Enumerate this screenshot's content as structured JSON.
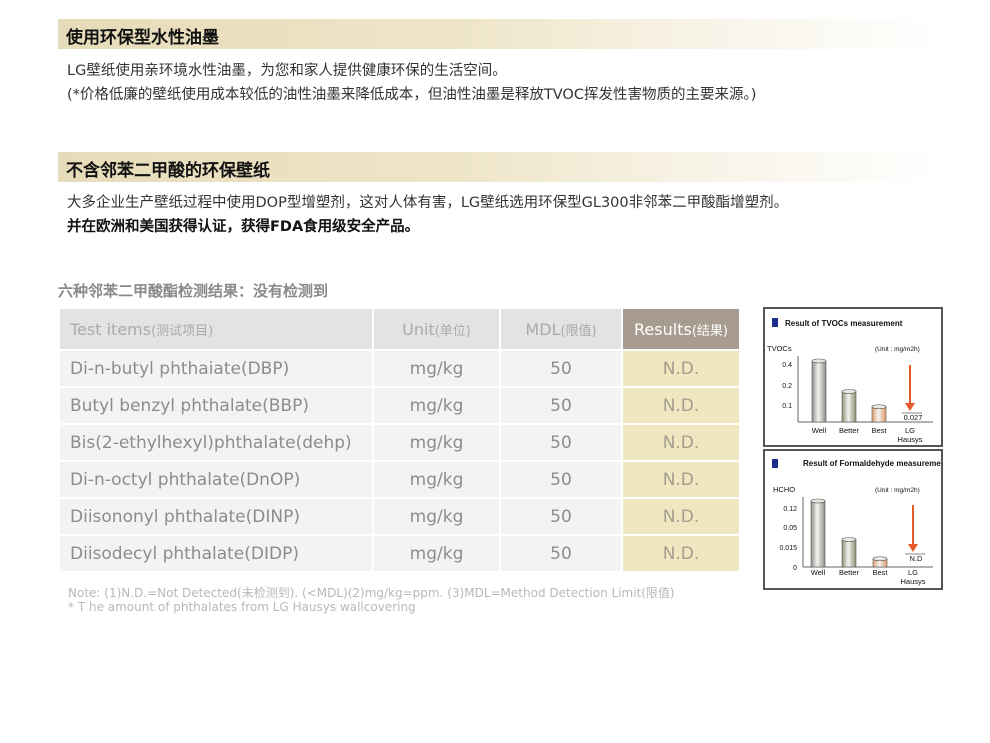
{
  "section1": {
    "title": "使用环保型水性油墨",
    "line1": "LG壁纸使用亲环境水性油墨，为您和家人提供健康环保的生活空间。",
    "line2": "(*价格低廉的壁纸使用成本较低的油性油墨来降低成本，但油性油墨是释放TVOC挥发性害物质的主要来源。)"
  },
  "section2": {
    "title": "不含邻苯二甲酸的环保壁纸",
    "line1": "大多企业生产壁纸过程中使用DOP型增塑剂，这对人体有害，LG壁纸选用环保型GL300非邻苯二甲酸酯增塑剂。",
    "line2": "并在欧洲和美国获得认证，获得FDA食用级安全产品。"
  },
  "table": {
    "title": "六种邻苯二甲酸酯检测结果：没有检测到",
    "headers": {
      "items": "Test items",
      "items_cn": "(测试项目)",
      "unit": "Unit",
      "unit_cn": "(单位)",
      "mdl": "MDL",
      "mdl_cn": "(限值)",
      "results": "Results",
      "results_cn": "(结果)"
    },
    "rows": [
      {
        "item": "Di-n-butyl phthaiate(DBP)",
        "unit": "mg/kg",
        "mdl": "50",
        "result": "N.D."
      },
      {
        "item": "Butyl benzyl phthalate(BBP)",
        "unit": "mg/kg",
        "mdl": "50",
        "result": "N.D."
      },
      {
        "item": "Bis(2-ethylhexyl)phthalate(dehp)",
        "unit": "mg/kg",
        "mdl": "50",
        "result": "N.D."
      },
      {
        "item": "Di-n-octyl phthalate(DnOP)",
        "unit": "mg/kg",
        "mdl": "50",
        "result": "N.D."
      },
      {
        "item": "Diisononyl phthalate(DINP)",
        "unit": "mg/kg",
        "mdl": "50",
        "result": "N.D."
      },
      {
        "item": "Diisodecyl phthalate(DIDP)",
        "unit": "mg/kg",
        "mdl": "50",
        "result": "N.D."
      }
    ],
    "note1": "Note: (1)N.D.=Not Detected(未检测到). (<MDL)(2)mg/kg=ppm. (3)MDL=Method Detection Limit(限值)",
    "note2": "* T he amount of phthalates from LG Hausys wallcovering"
  },
  "chart_data": [
    {
      "type": "bar",
      "title": "Result of TVOCs measurement",
      "ylabel": "TVOCs",
      "unit": "(Unit : mg/m2h)",
      "yticks": [
        "0.4",
        "0.2",
        "0.1"
      ],
      "categories": [
        "Well",
        "Better",
        "Best",
        "LG Hausys"
      ],
      "values": [
        0.4,
        0.2,
        0.1,
        0.027
      ],
      "value_label": "0.027",
      "colors": [
        "#8a8f88",
        "#8e8f72",
        "#e09a6a",
        "#e85a2a"
      ]
    },
    {
      "type": "bar",
      "title": "Result of Formaldehyde measurement",
      "ylabel": "HCHO",
      "unit": "(Unit : mg/m2h)",
      "yticks": [
        "0.12",
        "0.05",
        "0.015",
        "0"
      ],
      "categories": [
        "Well",
        "Better",
        "Best",
        "LG Hausys"
      ],
      "values": [
        0.12,
        0.05,
        0.015,
        0
      ],
      "value_label": "N.D",
      "colors": [
        "#8a8f88",
        "#8e8f72",
        "#e09a6a",
        "#e85a2a"
      ]
    }
  ]
}
